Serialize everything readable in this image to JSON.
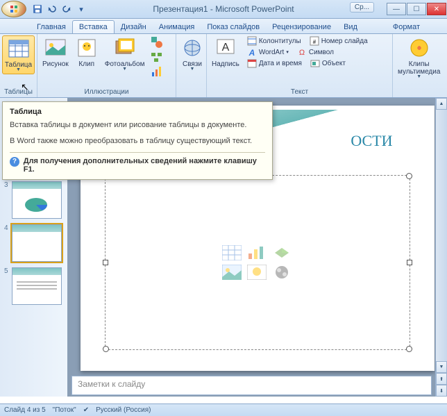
{
  "title": "Презентация1 - Microsoft PowerPoint",
  "tools_label": "Ср...",
  "tabs": {
    "home": "Главная",
    "insert": "Вставка",
    "design": "Дизайн",
    "anim": "Анимация",
    "show": "Показ слайдов",
    "review": "Рецензирование",
    "view": "Вид",
    "format": "Формат"
  },
  "ribbon": {
    "tables_group": "Таблицы",
    "table_btn": "Таблица",
    "illus_group": "Иллюстрации",
    "picture": "Рисунок",
    "clip": "Клип",
    "album": "Фотоальбом",
    "links_group": "",
    "links": "Связи",
    "text_group": "Текст",
    "textbox": "Надпись",
    "header_footer": "Колонтитулы",
    "slide_num": "Номер слайда",
    "wordart": "WordArt",
    "symbol": "Символ",
    "datetime": "Дата и время",
    "object": "Объект",
    "media": "Клипы\nмультимедиа"
  },
  "tooltip": {
    "title": "Таблица",
    "p1": "Вставка таблицы в документ или рисование таблицы в документе.",
    "p2": "В Word также можно преобразовать в таблицу существующий текст.",
    "help": "Для получения дополнительных сведений нажмите клавишу F1."
  },
  "slide_title": "ОСТИ",
  "notes_placeholder": "Заметки к слайду",
  "status": {
    "slide": "Слайд 4 из 5",
    "theme": "\"Поток\"",
    "lang": "Русский (Россия)"
  },
  "thumbs": [
    "3",
    "4",
    "5"
  ]
}
